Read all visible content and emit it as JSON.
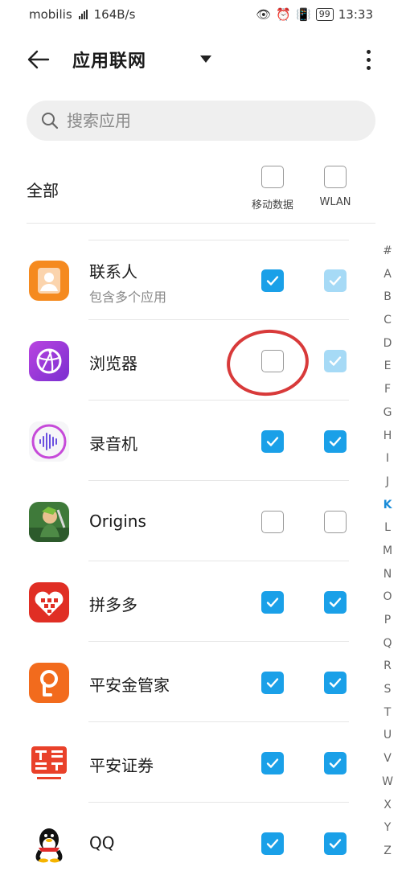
{
  "status_bar": {
    "carrier": "mobilis",
    "speed": "164B/s",
    "battery": "99",
    "time": "13:33"
  },
  "header": {
    "title": "应用联网"
  },
  "search": {
    "placeholder": "搜索应用"
  },
  "columns": {
    "all_label": "全部",
    "mobile_label": "移动数据",
    "wlan_label": "WLAN"
  },
  "apps": [
    {
      "name": "联系人",
      "subtitle": "包含多个应用",
      "mobile": "checked",
      "wlan": "faded"
    },
    {
      "name": "浏览器",
      "subtitle": "",
      "mobile": "unchecked",
      "wlan": "faded"
    },
    {
      "name": "录音机",
      "subtitle": "",
      "mobile": "checked",
      "wlan": "checked"
    },
    {
      "name": "Origins",
      "subtitle": "",
      "mobile": "unchecked",
      "wlan": "unchecked"
    },
    {
      "name": "拼多多",
      "subtitle": "",
      "mobile": "checked",
      "wlan": "checked"
    },
    {
      "name": "平安金管家",
      "subtitle": "",
      "mobile": "checked",
      "wlan": "checked"
    },
    {
      "name": "平安证券",
      "subtitle": "",
      "mobile": "checked",
      "wlan": "checked"
    },
    {
      "name": "QQ",
      "subtitle": "",
      "mobile": "checked",
      "wlan": "checked"
    }
  ],
  "alphabet_index": [
    "#",
    "A",
    "B",
    "C",
    "D",
    "E",
    "F",
    "G",
    "H",
    "I",
    "J",
    "K",
    "L",
    "M",
    "N",
    "O",
    "P",
    "Q",
    "R",
    "S",
    "T",
    "U",
    "V",
    "W",
    "X",
    "Y",
    "Z"
  ],
  "alphabet_active": "K",
  "colors": {
    "accent": "#1aa0e8",
    "accent_faded": "#a6daf6",
    "annotation": "#d83a3a"
  },
  "icons": {
    "back": "arrow-left-icon",
    "dropdown": "triangle-down-icon",
    "more": "more-vertical-icon",
    "search": "search-icon",
    "check": "check-icon"
  }
}
